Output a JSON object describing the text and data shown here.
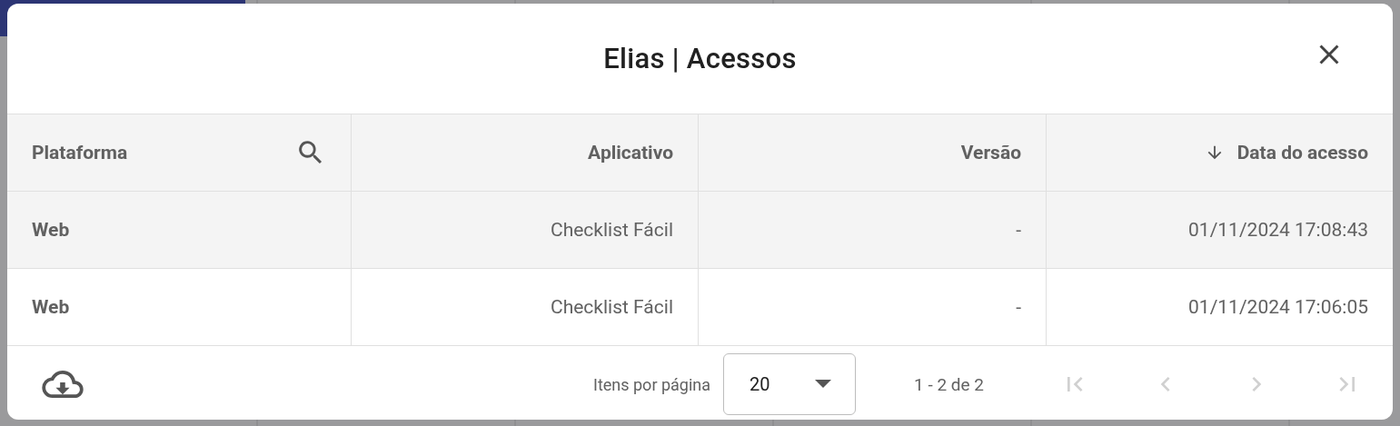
{
  "dialog": {
    "title": "Elias | Acessos"
  },
  "table": {
    "columns": [
      {
        "label": "Plataforma",
        "searchable": true,
        "sorted": false
      },
      {
        "label": "Aplicativo",
        "searchable": false,
        "sorted": false
      },
      {
        "label": "Versão",
        "searchable": false,
        "sorted": false
      },
      {
        "label": "Data do acesso",
        "searchable": false,
        "sorted": true
      }
    ],
    "rows": [
      {
        "cells": [
          "Web",
          "Checklist Fácil",
          "-",
          "01/11/2024 17:08:43"
        ]
      },
      {
        "cells": [
          "Web",
          "Checklist Fácil",
          "-",
          "01/11/2024 17:06:05"
        ]
      }
    ]
  },
  "paginator": {
    "items_per_page_label": "Itens por página",
    "page_size": "20",
    "range": "1 - 2 de 2",
    "buttons": [
      {
        "kind": "first",
        "disabled": true
      },
      {
        "kind": "prev",
        "disabled": true
      },
      {
        "kind": "next",
        "disabled": true
      },
      {
        "kind": "last",
        "disabled": true
      }
    ]
  }
}
